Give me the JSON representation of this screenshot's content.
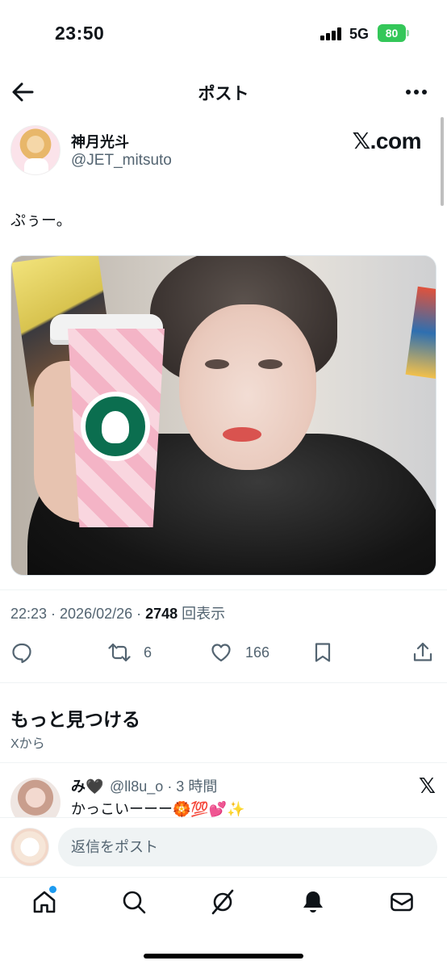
{
  "status_bar": {
    "time": "23:50",
    "network": "5G",
    "battery": "80"
  },
  "header": {
    "title": "ポスト",
    "back_icon": "back-arrow-icon",
    "more_icon": "more-icon"
  },
  "post": {
    "author": {
      "display_name": "神月光斗",
      "handle": "@JET_mitsuto"
    },
    "source_badge": "𝕏.com",
    "text": "ぷぅー。",
    "timestamp": "22:23 · 2026/02/26 · ",
    "views_count": "2748",
    "views_label": " 回表示",
    "actions": {
      "reply_count": "",
      "repost_count": "6",
      "like_count": "166"
    }
  },
  "discover": {
    "title": "もっと見つける",
    "subtitle": "Xから"
  },
  "reply_preview": {
    "name": "み🖤",
    "handle_time": "@ll8u_o · 3 時間",
    "text": "かっこいーーー🏵️💯💕✨",
    "badge": "𝕏"
  },
  "compose": {
    "placeholder": "返信をポスト"
  },
  "nav": {
    "items": [
      "home-icon",
      "search-icon",
      "grok-icon",
      "notifications-icon",
      "messages-icon"
    ]
  },
  "colors": {
    "accent": "#1d9bf0",
    "battery": "#34c759",
    "secondary_text": "#536471"
  }
}
